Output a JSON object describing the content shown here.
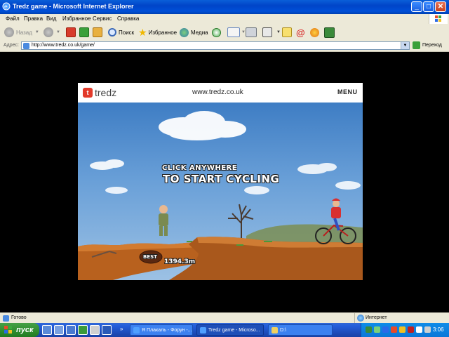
{
  "window": {
    "title": "Tredz game - Microsoft Internet Explorer"
  },
  "menu": [
    "Файл",
    "Правка",
    "Вид",
    "Избранное",
    "Сервис",
    "Справка"
  ],
  "toolbar": {
    "back": "Назад",
    "search": "Поиск",
    "favorites": "Избранное",
    "media": "Медиа"
  },
  "address": {
    "label": "Адрес:",
    "url": "http://www.tredz.co.uk/game/",
    "go": "Переход"
  },
  "game": {
    "logo": "tredz",
    "site": "www.tredz.co.uk",
    "menu": "MENU",
    "prompt_line1": "CLICK ANYWHERE",
    "prompt_line2": "TO START CYCLING",
    "best_label": "BEST",
    "best_value": "1394.3m"
  },
  "status": {
    "text": "Готово",
    "zone": "Интернет"
  },
  "taskbar": {
    "start": "пуск",
    "tasks": [
      "Я Плакаль - Форун -...",
      "Tredz game - Microso...",
      "D:\\"
    ],
    "clock": "3:06"
  }
}
